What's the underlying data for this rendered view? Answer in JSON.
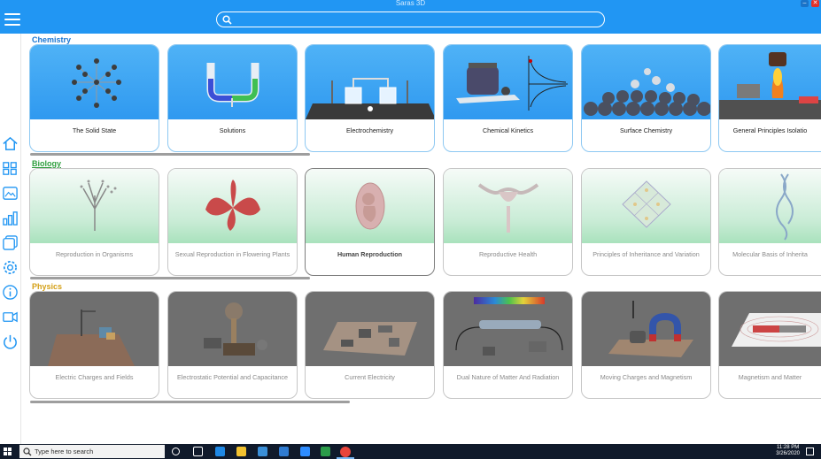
{
  "window": {
    "title": "Saras 3D"
  },
  "search": {
    "placeholder": "",
    "value": ""
  },
  "sections": {
    "chemistry": {
      "title": "Chemistry",
      "color": "#1976d2",
      "cards": [
        {
          "label": "The Solid State",
          "icon": "lattice-model"
        },
        {
          "label": "Solutions",
          "icon": "u-tube"
        },
        {
          "label": "Electrochemistry",
          "icon": "electrochemical-cell"
        },
        {
          "label": "Chemical Kinetics",
          "icon": "kinetics-graph"
        },
        {
          "label": "Surface Chemistry",
          "icon": "adsorption-spheres"
        },
        {
          "label": "General Principles Isolatio",
          "icon": "furnace"
        }
      ]
    },
    "biology": {
      "title": "Biology",
      "color": "#2e9e3e",
      "cards": [
        {
          "label": "Reproduction in Organisms",
          "icon": "plant-spores"
        },
        {
          "label": "Sexual Reproduction in Flowering Plants",
          "icon": "lily-flower"
        },
        {
          "label": "Human Reproduction",
          "icon": "fetus-in-womb",
          "selected": true
        },
        {
          "label": "Reproductive Health",
          "icon": "uterus"
        },
        {
          "label": "Principles of Inheritance and Variation",
          "icon": "punnett-lattice"
        },
        {
          "label": "Molecular Basis of Inherita",
          "icon": "dna-helix"
        }
      ]
    },
    "physics": {
      "title": "Physics",
      "color": "#d4a017",
      "cards": [
        {
          "label": "Electric Charges and Fields",
          "icon": "charge-stand"
        },
        {
          "label": "Electrostatic Potential and Capacitance",
          "icon": "van-de-graaff"
        },
        {
          "label": "Current Electricity",
          "icon": "circuit-board"
        },
        {
          "label": "Dual Nature of Matter And Radiation",
          "icon": "spectrum-tube"
        },
        {
          "label": "Moving Charges and Magnetism",
          "icon": "horseshoe-magnet"
        },
        {
          "label": "Magnetism and Matter",
          "icon": "bar-magnet-field"
        }
      ]
    }
  },
  "sidebar": [
    "home-icon",
    "grid-icon",
    "image-icon",
    "bar-chart-icon",
    "layers-icon",
    "gear-icon",
    "info-icon",
    "video-icon",
    "power-icon"
  ],
  "taskbar": {
    "search_placeholder": "Type here to search",
    "time": "11:28 PM",
    "date": "3/26/2020"
  }
}
